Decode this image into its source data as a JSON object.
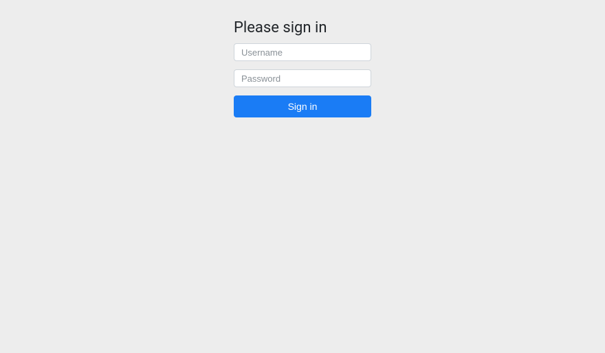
{
  "login": {
    "heading": "Please sign in",
    "username_placeholder": "Username",
    "password_placeholder": "Password",
    "username_value": "",
    "password_value": "",
    "button_label": "Sign in"
  }
}
